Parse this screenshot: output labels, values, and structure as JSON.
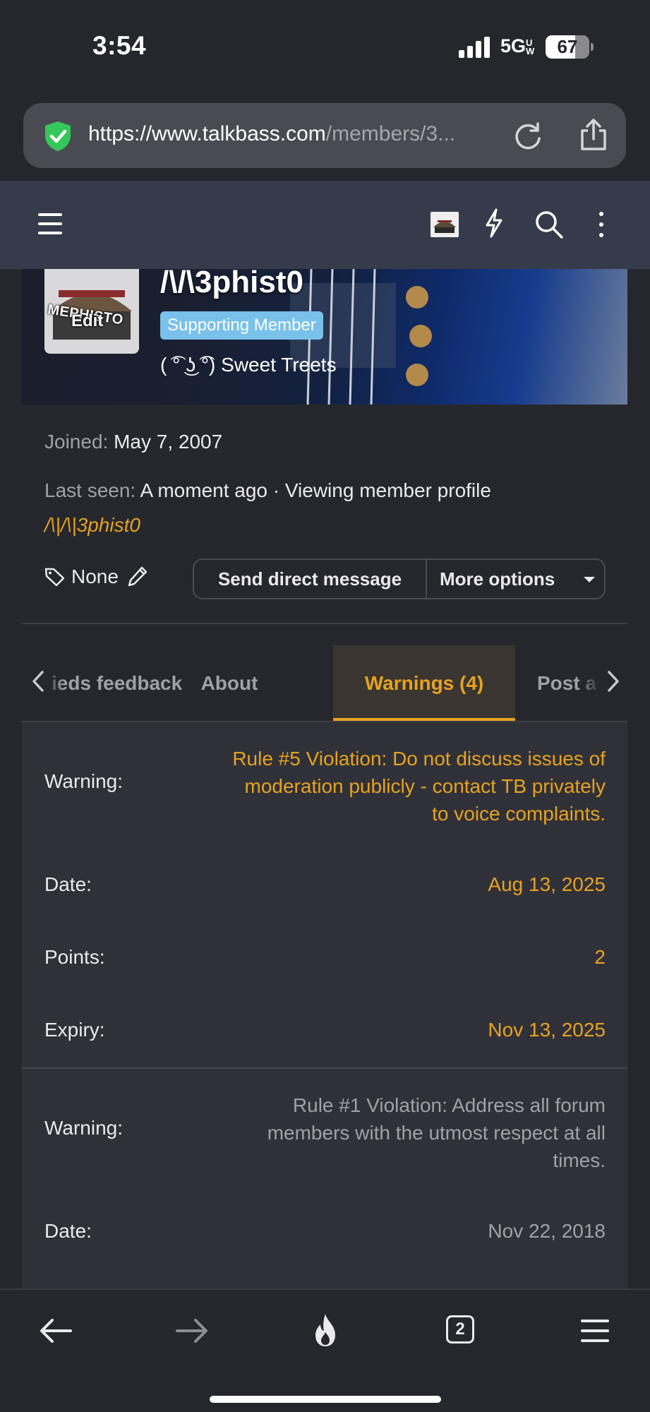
{
  "status_bar": {
    "time": "3:54",
    "network": "5G",
    "network_sub": "UW",
    "battery_level": "67",
    "battery_fraction": 0.67
  },
  "browser": {
    "url_host": "https://www.talkbass.com",
    "url_path": "/members/3..."
  },
  "profile": {
    "avatar_text_top": "MEPHISTO",
    "avatar_text_edit": "Edit",
    "username": "/\\/\\3phist0",
    "badge": "Supporting Member",
    "custom_title": "( ͡° ͜ʖ ͡°) Sweet Treets",
    "joined_label": "Joined:",
    "joined_value": "May 7, 2007",
    "last_seen_label": "Last seen:",
    "last_seen_value": "A moment ago · Viewing member profile",
    "viewing_link": "/\\|/\\|3phist0",
    "tags_value": "None",
    "send_message": "Send direct message",
    "more_options": "More options"
  },
  "tabs": {
    "items": [
      "ieds feedback",
      "About",
      "Warnings (4)",
      "Post a"
    ],
    "active": "Warnings (4)"
  },
  "warnings": [
    {
      "warning_label": "Warning:",
      "warning_lines": [
        "Rule #5 Violation: Do not discuss issues of",
        "moderation publicly - contact TB privately",
        "to voice complaints."
      ],
      "date_label": "Date:",
      "date": "Aug 13, 2025",
      "points_label": "Points:",
      "points": "2",
      "expiry_label": "Expiry:",
      "expiry": "Nov 13, 2025",
      "color": "#e6a221"
    },
    {
      "warning_label": "Warning:",
      "warning_lines": [
        "Rule #1 Violation: Address all forum",
        "members with the utmost respect at all",
        "times."
      ],
      "date_label": "Date:",
      "date": "Nov 22, 2018",
      "color": "#a0a1a8"
    }
  ],
  "bottom_bar": {
    "tab_count": "2"
  },
  "colors": {
    "accent": "#e6a221",
    "header": "#363b4b",
    "background": "#26272d",
    "badge": "#79c1ea"
  }
}
